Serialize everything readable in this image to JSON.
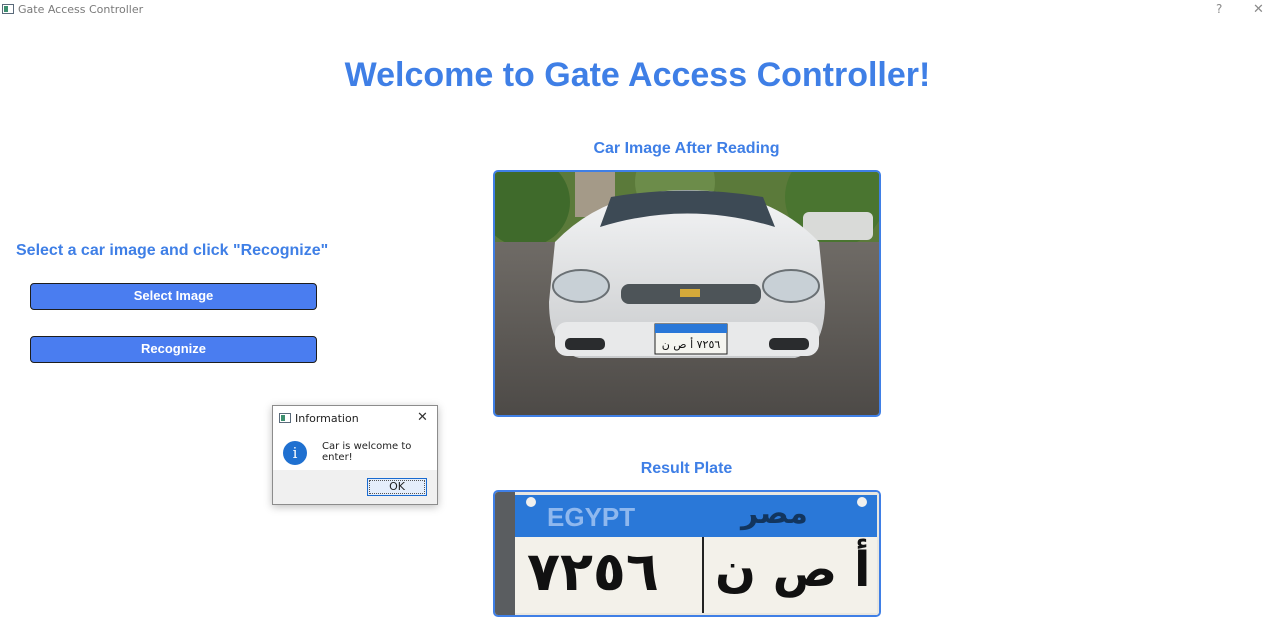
{
  "window": {
    "title": "Gate Access Controller",
    "help_glyph": "?",
    "close_glyph": "✕"
  },
  "main": {
    "title": "Welcome to Gate Access Controller!",
    "instruction": "Select a car image and click \"Recognize\"",
    "select_button": "Select Image",
    "recognize_button": "Recognize",
    "car_image_title": "Car Image After Reading",
    "result_plate_title": "Result Plate"
  },
  "plate": {
    "country_en": "EGYPT",
    "country_ar": "مصر",
    "number": "٧٢٥٦",
    "letters": "أ ص ن"
  },
  "dialog": {
    "title": "Information",
    "message": "Car is welcome to enter!",
    "ok_label": "OK",
    "close_glyph": "✕",
    "info_glyph": "i"
  },
  "colors": {
    "accent": "#3f7fe6",
    "button": "#4a7df0",
    "plate_blue": "#2a78d8"
  },
  "icons": [
    "app-icon",
    "help-icon",
    "close-icon",
    "info-icon"
  ]
}
